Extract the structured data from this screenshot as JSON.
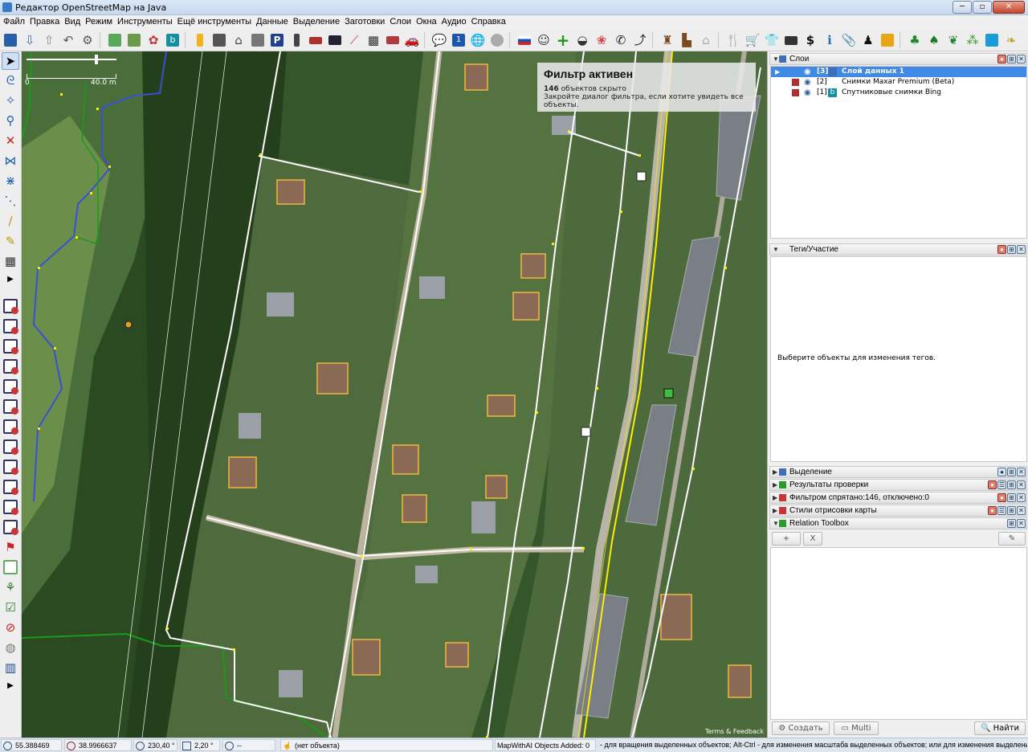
{
  "window": {
    "title": "Редактор OpenStreetMap на Java"
  },
  "menu": [
    "Файл",
    "Правка",
    "Вид",
    "Режим",
    "Инструменты",
    "Ещё инструменты",
    "Данные",
    "Выделение",
    "Заготовки",
    "Слои",
    "Окна",
    "Аудио",
    "Справка"
  ],
  "map": {
    "scale_zero": "0",
    "scale_distance": "40.0 m",
    "filter_title": "Фильтр активен",
    "filter_count": "146",
    "filter_count_suffix": "объектов скрыто",
    "filter_hint": "Закройте диалог фильтра, если хотите увидеть все объекты.",
    "terms": "Terms & Feedback"
  },
  "panels": {
    "layers": {
      "title": "Слои",
      "rows": [
        {
          "num": "[3]",
          "name": "Слой данных 1"
        },
        {
          "num": "[2]",
          "name": "Снимки Maxar Premium (Beta)"
        },
        {
          "num": "[1]",
          "name": "Спутниковые снимки Bing"
        }
      ]
    },
    "tags": {
      "title": "Теги/Участие",
      "empty_text": "Выберите объекты для изменения тегов."
    },
    "selection": {
      "title": "Выделение"
    },
    "validation": {
      "title": "Результаты проверки"
    },
    "filter": {
      "title": "Фильтром спрятано:146, отключено:0"
    },
    "map_styles": {
      "title": "Стили отрисовки карты"
    },
    "relation_toolbox": {
      "title": "Relation Toolbox",
      "add_label": "+",
      "remove_label": "X",
      "create_label": "Создать",
      "multi_label": "Multi",
      "find_label": "Найти"
    }
  },
  "status": {
    "lat": "55.388469",
    "lon": "38.9966637",
    "heading": "230,40 °",
    "angle": "2,20 °",
    "distance": "--",
    "object": "(нет объекта)",
    "mapwithai": "MapWithAI Objects Added: 0",
    "help": "- для вращения выделенных объектов; Alt-Ctrl - для изменения масштаба выделенных объектов; или для изменения выделения"
  },
  "colors": {
    "selected_row": "#3e8ae6",
    "way_white": "#ffffff",
    "way_yellow": "#ffee00",
    "building_outline": "#f0b840",
    "water_outline": "#3a4fd6",
    "forest_outline": "#1a9a1a"
  }
}
